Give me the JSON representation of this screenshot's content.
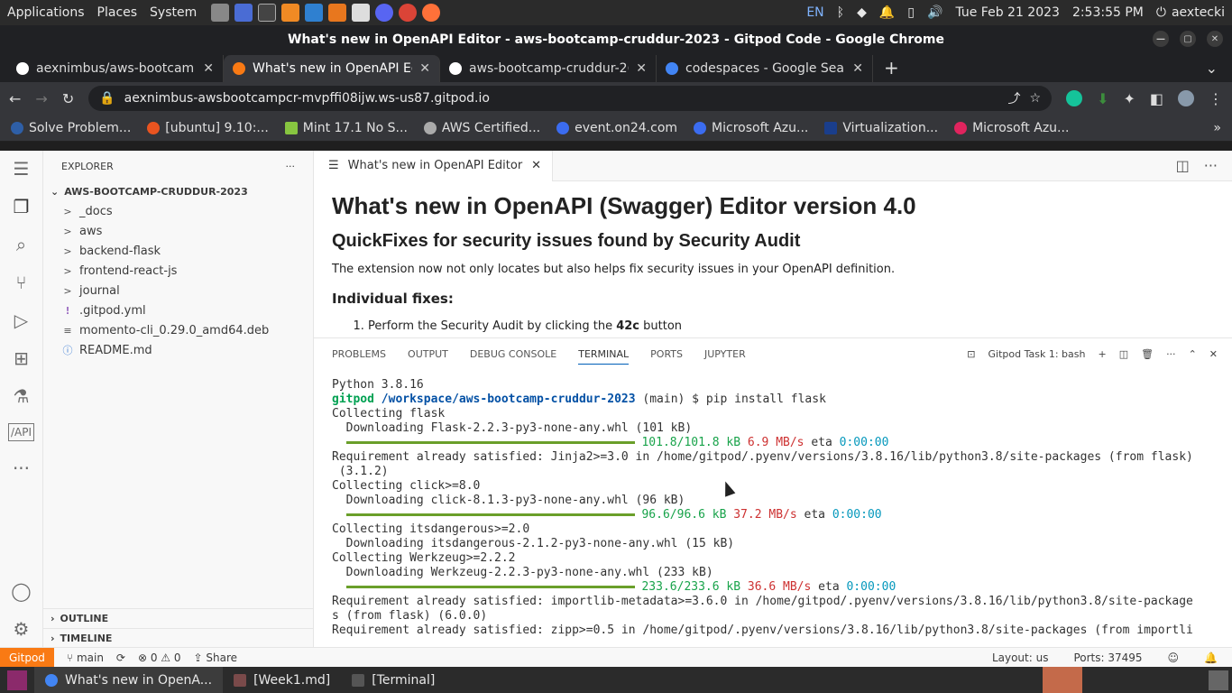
{
  "panel": {
    "menus": [
      "Applications",
      "Places",
      "System"
    ],
    "lang": "EN",
    "datetime": "Tue Feb 21 2023",
    "time": "2:53:55 PM",
    "user": "aextecki"
  },
  "window": {
    "title": "What's new in OpenAPI Editor - aws-bootcamp-cruddur-2023 - Gitpod Code - Google Chrome"
  },
  "tabs": [
    {
      "label": "aexnimbus/aws-bootcam",
      "color": "#ffffff"
    },
    {
      "label": "What's new in OpenAPI Ed",
      "color": "#f97a14"
    },
    {
      "label": "aws-bootcamp-cruddur-2(",
      "color": "#ffffff"
    },
    {
      "label": "codespaces - Google Searc",
      "color": "#4285f4"
    }
  ],
  "omnibox": {
    "url": "aexnimbus-awsbootcampcr-mvpffi08ijw.ws-us87.gitpod.io"
  },
  "bookmarks": [
    {
      "label": "Solve Problem...",
      "color": "#2e5fa7"
    },
    {
      "label": "[ubuntu] 9.10:...",
      "color": "#e95420"
    },
    {
      "label": "Mint 17.1 No S...",
      "color": "#87c540"
    },
    {
      "label": "AWS Certified...",
      "color": "#aaaaaa"
    },
    {
      "label": "event.on24.com",
      "color": "#3b6cf0"
    },
    {
      "label": "Microsoft Azu...",
      "color": "#3b6cf0"
    },
    {
      "label": "Virtualization...",
      "color": "#1a3e8c"
    },
    {
      "label": "Microsoft Azu...",
      "color": "#e0245e"
    }
  ],
  "explorer": {
    "title": "EXPLORER",
    "project": "AWS-BOOTCAMP-CRUDDUR-2023",
    "items": [
      {
        "label": "_docs",
        "icon": ">"
      },
      {
        "label": "aws",
        "icon": ">"
      },
      {
        "label": "backend-flask",
        "icon": ">"
      },
      {
        "label": "frontend-react-js",
        "icon": ">"
      },
      {
        "label": "journal",
        "icon": ">"
      },
      {
        "label": ".gitpod.yml",
        "icon": "!"
      },
      {
        "label": "momento-cli_0.29.0_amd64.deb",
        "icon": "≡"
      },
      {
        "label": "README.md",
        "icon": "ⓘ"
      }
    ],
    "outline": "OUTLINE",
    "timeline": "TIMELINE"
  },
  "editor": {
    "tab": "What's new in OpenAPI Editor",
    "h1": "What's new in OpenAPI (Swagger) Editor version 4.0",
    "h2": "QuickFixes for security issues found by Security Audit",
    "p": "The extension now not only locates but also helps fix security issues in your OpenAPI definition.",
    "h3": "Individual fixes:",
    "li_a": "Perform the Security Audit by clicking the ",
    "li_b": "42c",
    "li_c": " button"
  },
  "panel_tabs": [
    "PROBLEMS",
    "OUTPUT",
    "DEBUG CONSOLE",
    "TERMINAL",
    "PORTS",
    "JUPYTER"
  ],
  "terminal": {
    "task": "Gitpod Task 1: bash",
    "l1": "Python 3.8.16",
    "prompt_user": "gitpod",
    "prompt_path": "/workspace/aws-bootcamp-cruddur-2023",
    "prompt_branch": " (main) $ ",
    "prompt_cmd": "pip install flask",
    "l3": "Collecting flask",
    "l4": "  Downloading Flask-2.2.3-py3-none-any.whl (101 kB)",
    "p1_size": "101.8/101.8 kB",
    "p1_speed": "6.9 MB/s",
    "p1_eta": "0:00:00",
    "l6": "Requirement already satisfied: Jinja2>=3.0 in /home/gitpod/.pyenv/versions/3.8.16/lib/python3.8/site-packages (from flask)",
    "l7": " (3.1.2)",
    "l8": "Collecting click>=8.0",
    "l9": "  Downloading click-8.1.3-py3-none-any.whl (96 kB)",
    "p2_size": "96.6/96.6 kB",
    "p2_speed": "37.2 MB/s",
    "p2_eta": "0:00:00",
    "l11": "Collecting itsdangerous>=2.0",
    "l12": "  Downloading itsdangerous-2.1.2-py3-none-any.whl (15 kB)",
    "l13": "Collecting Werkzeug>=2.2.2",
    "l14": "  Downloading Werkzeug-2.2.3-py3-none-any.whl (233 kB)",
    "p3_size": "233.6/233.6 kB",
    "p3_speed": "36.6 MB/s",
    "p3_eta": "0:00:00",
    "l16": "Requirement already satisfied: importlib-metadata>=3.6.0 in /home/gitpod/.pyenv/versions/3.8.16/lib/python3.8/site-package",
    "l17": "s (from flask) (6.0.0)",
    "l18": "Requirement already satisfied: zipp>=0.5 in /home/gitpod/.pyenv/versions/3.8.16/lib/python3.8/site-packages (from importli"
  },
  "status": {
    "gitpod": "Gitpod",
    "branch": "main",
    "problems": "⊗ 0 ⚠ 0",
    "share": "Share",
    "layout": "Layout: us",
    "ports": "Ports: 37495"
  },
  "taskbar": [
    {
      "label": "What's new in OpenA...",
      "color": "#4285f4"
    },
    {
      "label": "[Week1.md]",
      "color": "#7a4a4a"
    },
    {
      "label": "[Terminal]",
      "color": "#555555"
    }
  ]
}
